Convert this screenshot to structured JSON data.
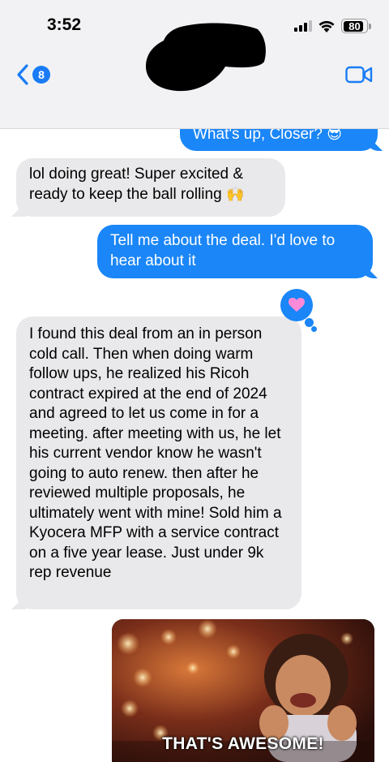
{
  "status_bar": {
    "time": "3:52",
    "battery": "80"
  },
  "header": {
    "back_badge": "8",
    "accent": "#1a7cf5"
  },
  "messages": [
    {
      "direction": "outgoing",
      "text": "What's up, Closer?",
      "emoji": "😎"
    },
    {
      "direction": "incoming",
      "text": "lol doing great! Super excited & ready to keep the ball rolling",
      "emoji": "🙌"
    },
    {
      "direction": "outgoing",
      "text": "Tell me about the deal. I'd love to hear about it"
    },
    {
      "direction": "incoming",
      "text": "I found this deal from an in person cold call. Then when doing warm follow ups, he realized his Ricoh contract expired at the end of 2024 and agreed to let us come in for a meeting. after meeting with us, he let his current vendor know he wasn't going to auto renew. then after he reviewed multiple proposals, he ultimately went with mine! Sold him a Kyocera MFP with a service contract on a five year lease. Just under 9k rep revenue"
    }
  ],
  "reaction": {
    "icon": "heart-icon",
    "color": "#ff8ad8"
  },
  "gif": {
    "caption": "THAT'S AWESOME!"
  },
  "colors": {
    "outgoing_bubble": "#1a86f7",
    "incoming_bubble": "#e9e9eb"
  }
}
